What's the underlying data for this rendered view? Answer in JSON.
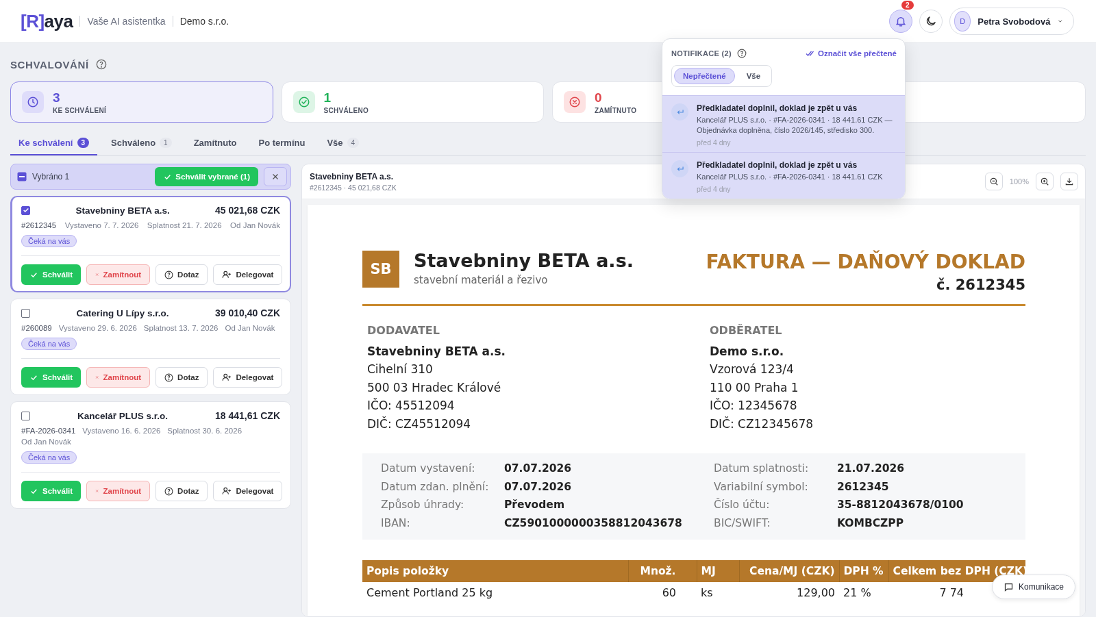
{
  "header": {
    "logo_mark": "[R]",
    "logo_rest": "aya",
    "tagline": "Vaše AI asistentka",
    "company": "Demo s.r.o.",
    "notification_count": "2",
    "user": {
      "initial": "D",
      "name": "Petra Svobodová"
    }
  },
  "page_title": "SCHVALOVÁNÍ",
  "stats": [
    {
      "kind": "pending",
      "value": "3",
      "label": "KE SCHVÁLENÍ",
      "selected": true
    },
    {
      "kind": "approved",
      "value": "1",
      "label": "SCHVÁLENO",
      "selected": false
    },
    {
      "kind": "rejected",
      "value": "0",
      "label": "ZAMÍTNUTO",
      "selected": false
    }
  ],
  "tabs": [
    {
      "label": "Ke schválení",
      "count": "3",
      "selected": true
    },
    {
      "label": "Schváleno",
      "count": "1",
      "selected": false
    },
    {
      "label": "Zamítnuto",
      "selected": false
    },
    {
      "label": "Po termínu",
      "selected": false
    },
    {
      "label": "Vše",
      "count": "4",
      "selected": false
    }
  ],
  "selection_bar": {
    "label": "Vybráno 1",
    "approve_button": "Schválit vybrané (1)"
  },
  "invoices": [
    {
      "company": "Stavebniny BETA a.s.",
      "amount": "45 021,68 CZK",
      "number": "#2612345",
      "issued": "Vystaveno 7. 7. 2026",
      "due": "Splatnost 21. 7. 2026",
      "from": "Od Jan Novák",
      "status": "Čeká na vás",
      "checked": true,
      "selected": true,
      "actions": [
        {
          "kind": "approve",
          "label": "Schválit"
        },
        {
          "kind": "reject",
          "label": "Zamítnout"
        },
        {
          "kind": "ask",
          "label": "Dotaz"
        },
        {
          "kind": "delegate",
          "label": "Delegovat"
        }
      ]
    },
    {
      "company": "Catering U Lípy s.r.o.",
      "amount": "39 010,40 CZK",
      "number": "#260089",
      "issued": "Vystaveno 29. 6. 2026",
      "due": "Splatnost 13. 7. 2026",
      "from": "Od Jan Novák",
      "status": "Čeká na vás",
      "checked": false,
      "selected": false,
      "actions": [
        {
          "kind": "approve",
          "label": "Schválit"
        },
        {
          "kind": "reject",
          "label": "Zamítnout"
        },
        {
          "kind": "ask",
          "label": "Dotaz"
        },
        {
          "kind": "delegate",
          "label": "Delegovat"
        }
      ]
    },
    {
      "company": "Kancelář PLUS s.r.o.",
      "amount": "18 441,61 CZK",
      "number": "#FA-2026-0341",
      "issued": "Vystaveno 16. 6. 2026",
      "due": "Splatnost 30. 6. 2026",
      "from": "Od Jan Novák",
      "status": "Čeká na vás",
      "checked": false,
      "selected": false,
      "actions": [
        {
          "kind": "approve",
          "label": "Schválit"
        },
        {
          "kind": "reject",
          "label": "Zamítnout"
        },
        {
          "kind": "ask",
          "label": "Dotaz"
        },
        {
          "kind": "delegate",
          "label": "Delegovat"
        }
      ]
    }
  ],
  "preview": {
    "title": "Stavebniny BETA a.s.",
    "subtitle": "#2612345 · 45 021,68 CZK",
    "zoom": "100%"
  },
  "document": {
    "logo": "SB",
    "supplier_name": "Stavebniny BETA a.s.",
    "supplier_tagline": "stavební materiál a řezivo",
    "title": "FAKTURA — DAŇOVÝ DOKLAD",
    "number": "č. 2612345",
    "parties": [
      {
        "heading": "DODAVATEL",
        "name": "Stavebniny BETA a.s.",
        "lines": [
          "Cihelní 310",
          "500 03 Hradec Králové",
          "IČO: 45512094",
          "DIČ: CZ45512094"
        ]
      },
      {
        "heading": "ODBĚRATEL",
        "name": "Demo s.r.o.",
        "lines": [
          "Vzorová 123/4",
          "110 00 Praha 1",
          "IČO: 12345678",
          "DIČ: CZ12345678"
        ]
      }
    ],
    "details": [
      {
        "label": "Datum vystavení:",
        "value": "07.07.2026"
      },
      {
        "label": "Datum splatnosti:",
        "value": "21.07.2026"
      },
      {
        "label": "Datum zdan. plnění:",
        "value": "07.07.2026"
      },
      {
        "label": "Variabilní symbol:",
        "value": "2612345"
      },
      {
        "label": "Způsob úhrady:",
        "value": "Převodem"
      },
      {
        "label": "Číslo účtu:",
        "value": "35-8812043678/0100"
      },
      {
        "label": "IBAN:",
        "value": "CZ5901000000358812043678"
      },
      {
        "label": "BIC/SWIFT:",
        "value": "KOMBCZPP"
      }
    ],
    "table": {
      "columns": [
        "Popis položky",
        "Množ.",
        "MJ",
        "Cena/MJ (CZK)",
        "DPH %",
        "Celkem bez DPH (CZK)"
      ],
      "rows": [
        [
          "Cement Portland 25 kg",
          "60",
          "ks",
          "129,00",
          "21 %",
          "7 74"
        ]
      ]
    }
  },
  "notifications": {
    "title": "NOTIFIKACE (2)",
    "mark_all": "Označit vše přečtené",
    "filters": [
      {
        "label": "Nepřečtené",
        "selected": true
      },
      {
        "label": "Vše",
        "selected": false
      }
    ],
    "items": [
      {
        "title": "Předkladatel doplnil, doklad je zpět u vás",
        "body": "Kancelář PLUS s.r.o. · #FA-2026-0341 · 18 441.61 CZK — Objednávka doplněna, číslo 2026/145, středisko 300.",
        "time": "před 4 dny",
        "unread": true
      },
      {
        "title": "Předkladatel doplnil, doklad je zpět u vás",
        "body": "Kancelář PLUS s.r.o. · #FA-2026-0341 · 18 441.61 CZK",
        "time": "před 4 dny",
        "unread": true
      }
    ]
  },
  "chat_button": "Komunikace"
}
